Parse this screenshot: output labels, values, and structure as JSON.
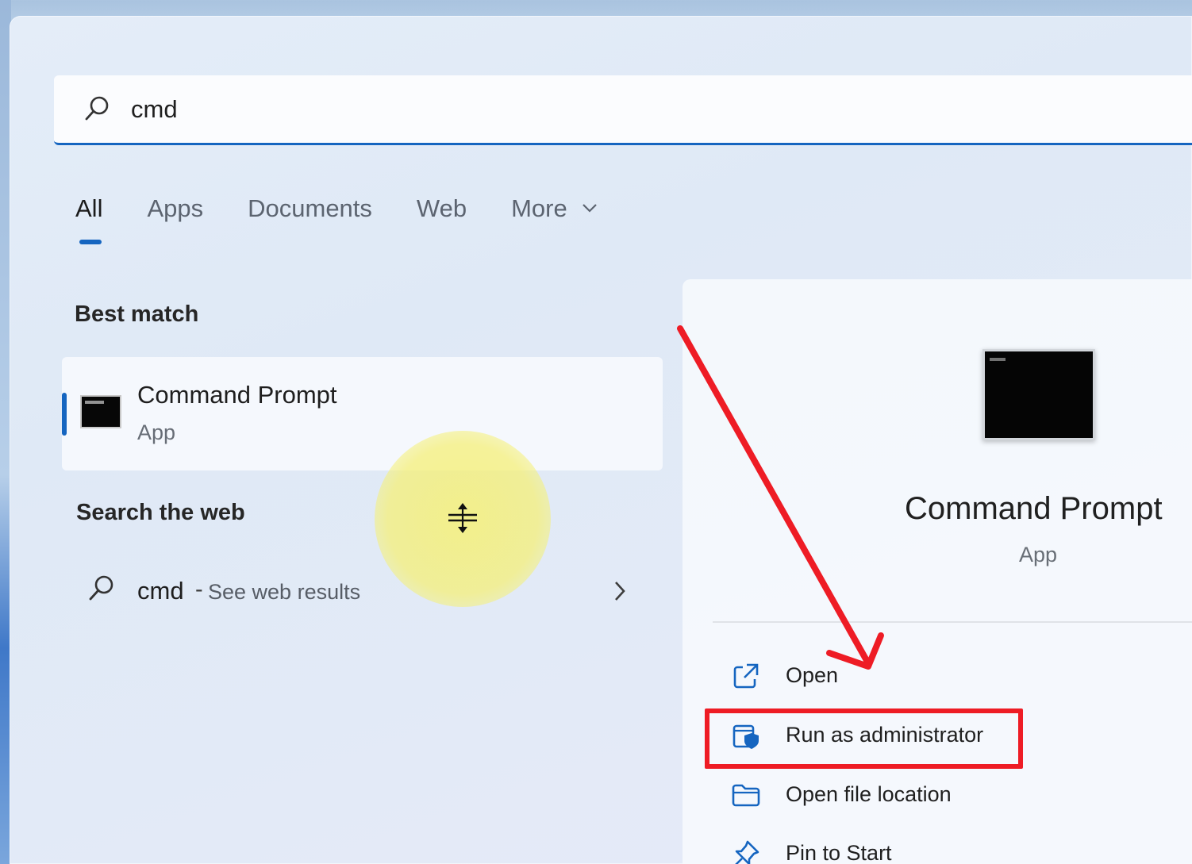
{
  "search": {
    "value": "cmd",
    "placeholder": ""
  },
  "tabs": [
    {
      "label": "All",
      "active": true
    },
    {
      "label": "Apps",
      "active": false
    },
    {
      "label": "Documents",
      "active": false
    },
    {
      "label": "Web",
      "active": false
    },
    {
      "label": "More",
      "active": false
    }
  ],
  "best_match": {
    "section_label": "Best match",
    "title": "Command Prompt",
    "subtitle": "App"
  },
  "web_search": {
    "section_label": "Search the web",
    "query": "cmd",
    "separator": "-",
    "hint": "See web results"
  },
  "details": {
    "title": "Command Prompt",
    "subtitle": "App",
    "actions": [
      {
        "label": "Open",
        "icon": "open-external-icon"
      },
      {
        "label": "Run as administrator",
        "icon": "shield-admin-icon"
      },
      {
        "label": "Open file location",
        "icon": "folder-icon"
      },
      {
        "label": "Pin to Start",
        "icon": "pin-icon"
      }
    ]
  },
  "colors": {
    "accent": "#1565c0",
    "annotation": "#ee1c25",
    "cursor_highlight": "#f5f078"
  }
}
